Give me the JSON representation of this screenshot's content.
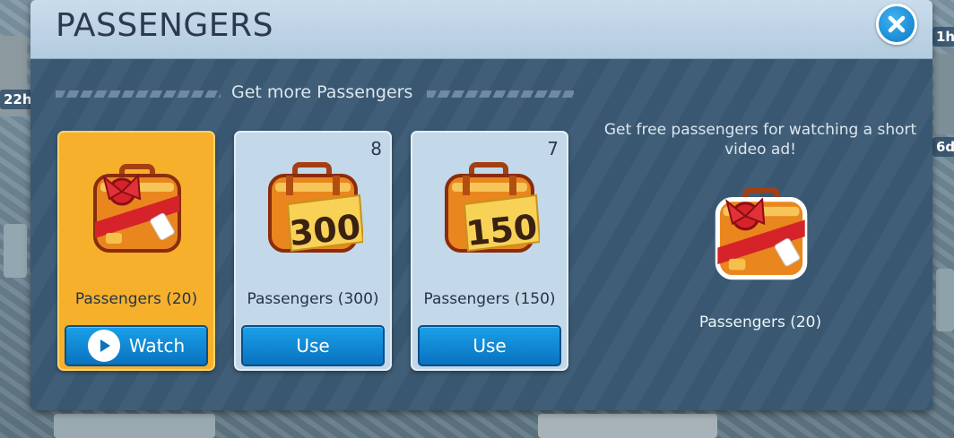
{
  "dialog": {
    "title": "PASSENGERS",
    "close_icon": "close-icon"
  },
  "section": {
    "title": "Get more Passengers"
  },
  "offers": [
    {
      "label": "Passengers (20)",
      "button": "Watch",
      "count": "",
      "icon": "gift-suitcase-icon",
      "selected": true
    },
    {
      "label": "Passengers (300)",
      "button": "Use",
      "count": "8",
      "icon": "suitcase-300-icon",
      "badge": "300"
    },
    {
      "label": "Passengers (150)",
      "button": "Use",
      "count": "7",
      "icon": "suitcase-150-icon",
      "badge": "150"
    }
  ],
  "detail": {
    "description": "Get free passengers for watching a short video ad!",
    "label": "Passengers (20)",
    "icon": "gift-suitcase-icon"
  },
  "background": {
    "tags": [
      "1h",
      "22h",
      "6d"
    ]
  },
  "colors": {
    "accent": "#0c78c8",
    "selected_card": "#f6b02c",
    "panel": "#3b5a74",
    "header": "#c9dcec"
  }
}
